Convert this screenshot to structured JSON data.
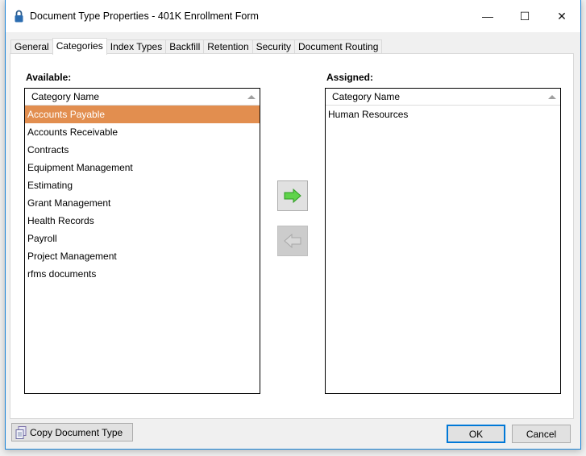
{
  "window": {
    "title": "Document Type Properties  - 401K Enrollment Form",
    "minimize": "—",
    "maximize": "☐",
    "close": "✕"
  },
  "tabs": [
    {
      "label": "General"
    },
    {
      "label": "Categories",
      "active": true
    },
    {
      "label": "Index Types"
    },
    {
      "label": "Backfill"
    },
    {
      "label": "Retention"
    },
    {
      "label": "Security"
    },
    {
      "label": "Document Routing"
    }
  ],
  "available": {
    "label": "Available:",
    "column": "Category Name",
    "items": [
      "Accounts Payable",
      "Accounts Receivable",
      "Contracts",
      "Equipment Management",
      "Estimating",
      "Grant Management",
      "Health Records",
      "Payroll",
      "Project Management",
      "rfms documents"
    ],
    "selected": "Accounts Payable"
  },
  "assigned": {
    "label": "Assigned:",
    "column": "Category Name",
    "items": [
      "Human Resources"
    ]
  },
  "buttons": {
    "copy": "Copy Document Type",
    "ok": "OK",
    "cancel": "Cancel"
  },
  "colors": {
    "selection": "#e28e4f",
    "accent": "#0078d7",
    "arrow_green": "#5fd34a"
  }
}
